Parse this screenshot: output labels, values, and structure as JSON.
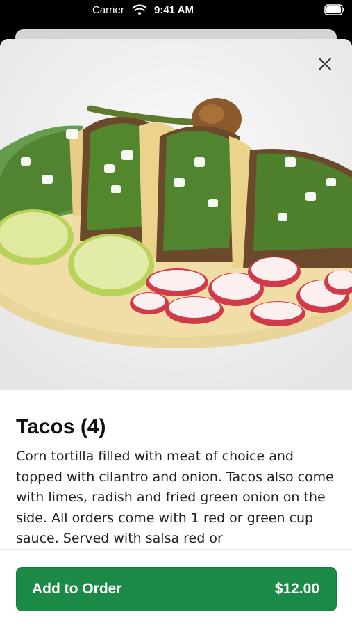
{
  "status_bar": {
    "carrier": "Carrier",
    "time": "9:41 AM"
  },
  "item": {
    "title": "Tacos (4)",
    "description": "Corn tortilla filled with meat of choice and topped with cilantro and onion. Tacos also come with limes, radish and fried green onion on the side. All orders come with 1 red or green cup sauce. Served with salsa red or"
  },
  "footer": {
    "add_label": "Add to Order",
    "price": "$12.00"
  },
  "colors": {
    "primary": "#1b8a46",
    "text": "#111111"
  },
  "icons": {
    "close": "close-icon",
    "wifi": "wifi-icon",
    "battery": "battery-icon"
  }
}
